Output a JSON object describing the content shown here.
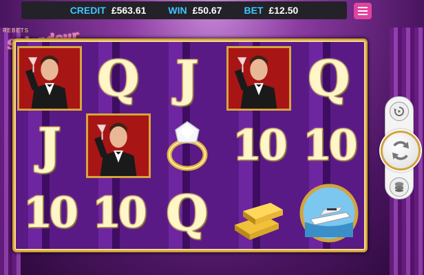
{
  "status": {
    "credit_label": "CREDIT",
    "credit_value": "£563.61",
    "win_label": "WIN",
    "win_value": "£50.67",
    "bet_label": "BET",
    "bet_value": "£12.50"
  },
  "logo": {
    "small": "REBETS",
    "big": "Splendour"
  },
  "reels": [
    [
      "man",
      "J",
      "10"
    ],
    [
      "Q",
      "man",
      "10"
    ],
    [
      "J",
      "ring",
      "Q"
    ],
    [
      "man",
      "10",
      "gold"
    ],
    [
      "Q",
      "10",
      "yacht"
    ]
  ],
  "grid_rows": [
    [
      {
        "symbol": "man",
        "label": ""
      },
      {
        "symbol": "Q",
        "label": "Q"
      },
      {
        "symbol": "J",
        "label": "J"
      },
      {
        "symbol": "man",
        "label": ""
      },
      {
        "symbol": "Q",
        "label": "Q"
      }
    ],
    [
      {
        "symbol": "J",
        "label": "J"
      },
      {
        "symbol": "man",
        "label": ""
      },
      {
        "symbol": "ring",
        "label": ""
      },
      {
        "symbol": "10",
        "label": "10"
      },
      {
        "symbol": "10",
        "label": "10"
      }
    ],
    [
      {
        "symbol": "10",
        "label": "10"
      },
      {
        "symbol": "10",
        "label": "10"
      },
      {
        "symbol": "Q",
        "label": "Q"
      },
      {
        "symbol": "gold",
        "label": ""
      },
      {
        "symbol": "yacht",
        "label": ""
      }
    ]
  ],
  "controls": {
    "menu_icon": "hamburger-icon",
    "autoplay_icon": "autoplay-icon",
    "spin_icon": "spin-icon",
    "stake_icon": "coin-stack-icon"
  },
  "colors": {
    "label_blue": "#3fc6ff",
    "menu_pink": "#e0449e",
    "gold": "#d4a43a",
    "reel_purple": "#5a1a86"
  }
}
